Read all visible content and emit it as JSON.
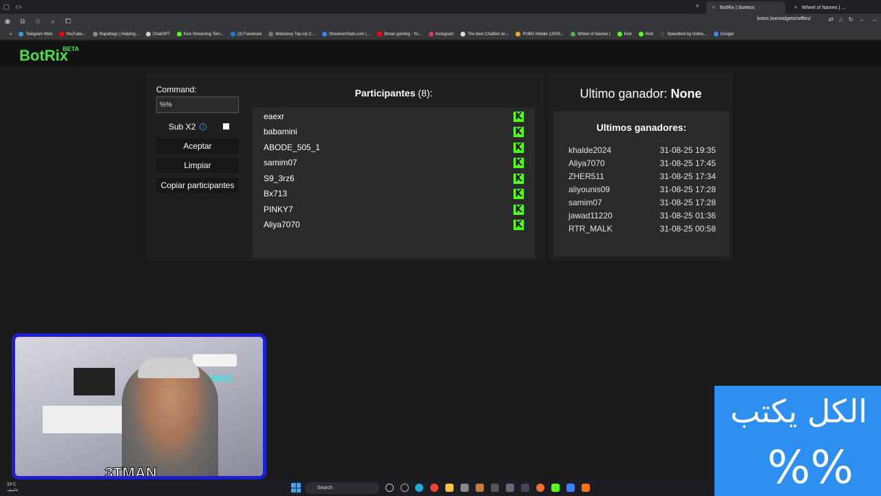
{
  "browser": {
    "tabs": [
      {
        "title": "BotRix | Sorteos",
        "active": true
      },
      {
        "title": "Wheel of Names | ...",
        "active": false
      }
    ],
    "url": "botrix.live/widgets/raffles/",
    "bookmarks": [
      "Telegram Web",
      "YouTube...",
      "Rapidtags | Helping...",
      "ChatGPT",
      "Kick Streaming Tem...",
      "(3) Facebook",
      "Midasbuy Top-Up C...",
      "StreamerStats.com |...",
      "3tman gaming - Yo...",
      "Instagram",
      "The best ChatBot an...",
      "PUBG Mobile 12000...",
      "Wheel of Names |",
      "Kick",
      "Kick",
      "Speedtest by Ookla...",
      "Google"
    ]
  },
  "app": {
    "logo": "BotRix",
    "beta": "BETA",
    "command_label": "Command:",
    "command_value": "%%",
    "sub_label": "Sub X2",
    "buttons": {
      "accept": "Aceptar",
      "clear": "Limpiar",
      "copy": "Copiar participantes"
    },
    "participants_title": "Participantes",
    "participants_count": "(8):",
    "participants": [
      {
        "name": "eaexr"
      },
      {
        "name": "babamini"
      },
      {
        "name": "ABODE_505_1"
      },
      {
        "name": "samim07"
      },
      {
        "name": "S9_3rz6"
      },
      {
        "name": "Bx713"
      },
      {
        "name": "PINKY7"
      },
      {
        "name": "Aliya7070"
      }
    ],
    "last_winner_label": "Ultimo ganador:",
    "last_winner_value": "None",
    "winners_title": "Ultimos ganadores:",
    "winners": [
      {
        "name": "khalde2024",
        "date": "31-08-25 19:35"
      },
      {
        "name": "Aliya7070",
        "date": "31-08-25 17:45"
      },
      {
        "name": "ZHER511",
        "date": "31-08-25 17:34"
      },
      {
        "name": "aliyounis09",
        "date": "31-08-25 17:28"
      },
      {
        "name": "samim07",
        "date": "31-08-25 17:28"
      },
      {
        "name": "jawad11220",
        "date": "31-08-25 01:36"
      },
      {
        "name": "RTR_MALK",
        "date": "31-08-25 00:58"
      }
    ]
  },
  "webcam": {
    "wall_text": "GAMING",
    "streamer_name": "3TMAN"
  },
  "overlay": {
    "arabic_text": "الكل يكتب",
    "symbol": "%%",
    "color": "#2d8ff0"
  },
  "taskbar": {
    "temperature": "33°C",
    "weather": "عاصف",
    "search_placeholder": "Search"
  },
  "colors": {
    "brand": "#4ade4a",
    "kick": "#53fc18"
  }
}
